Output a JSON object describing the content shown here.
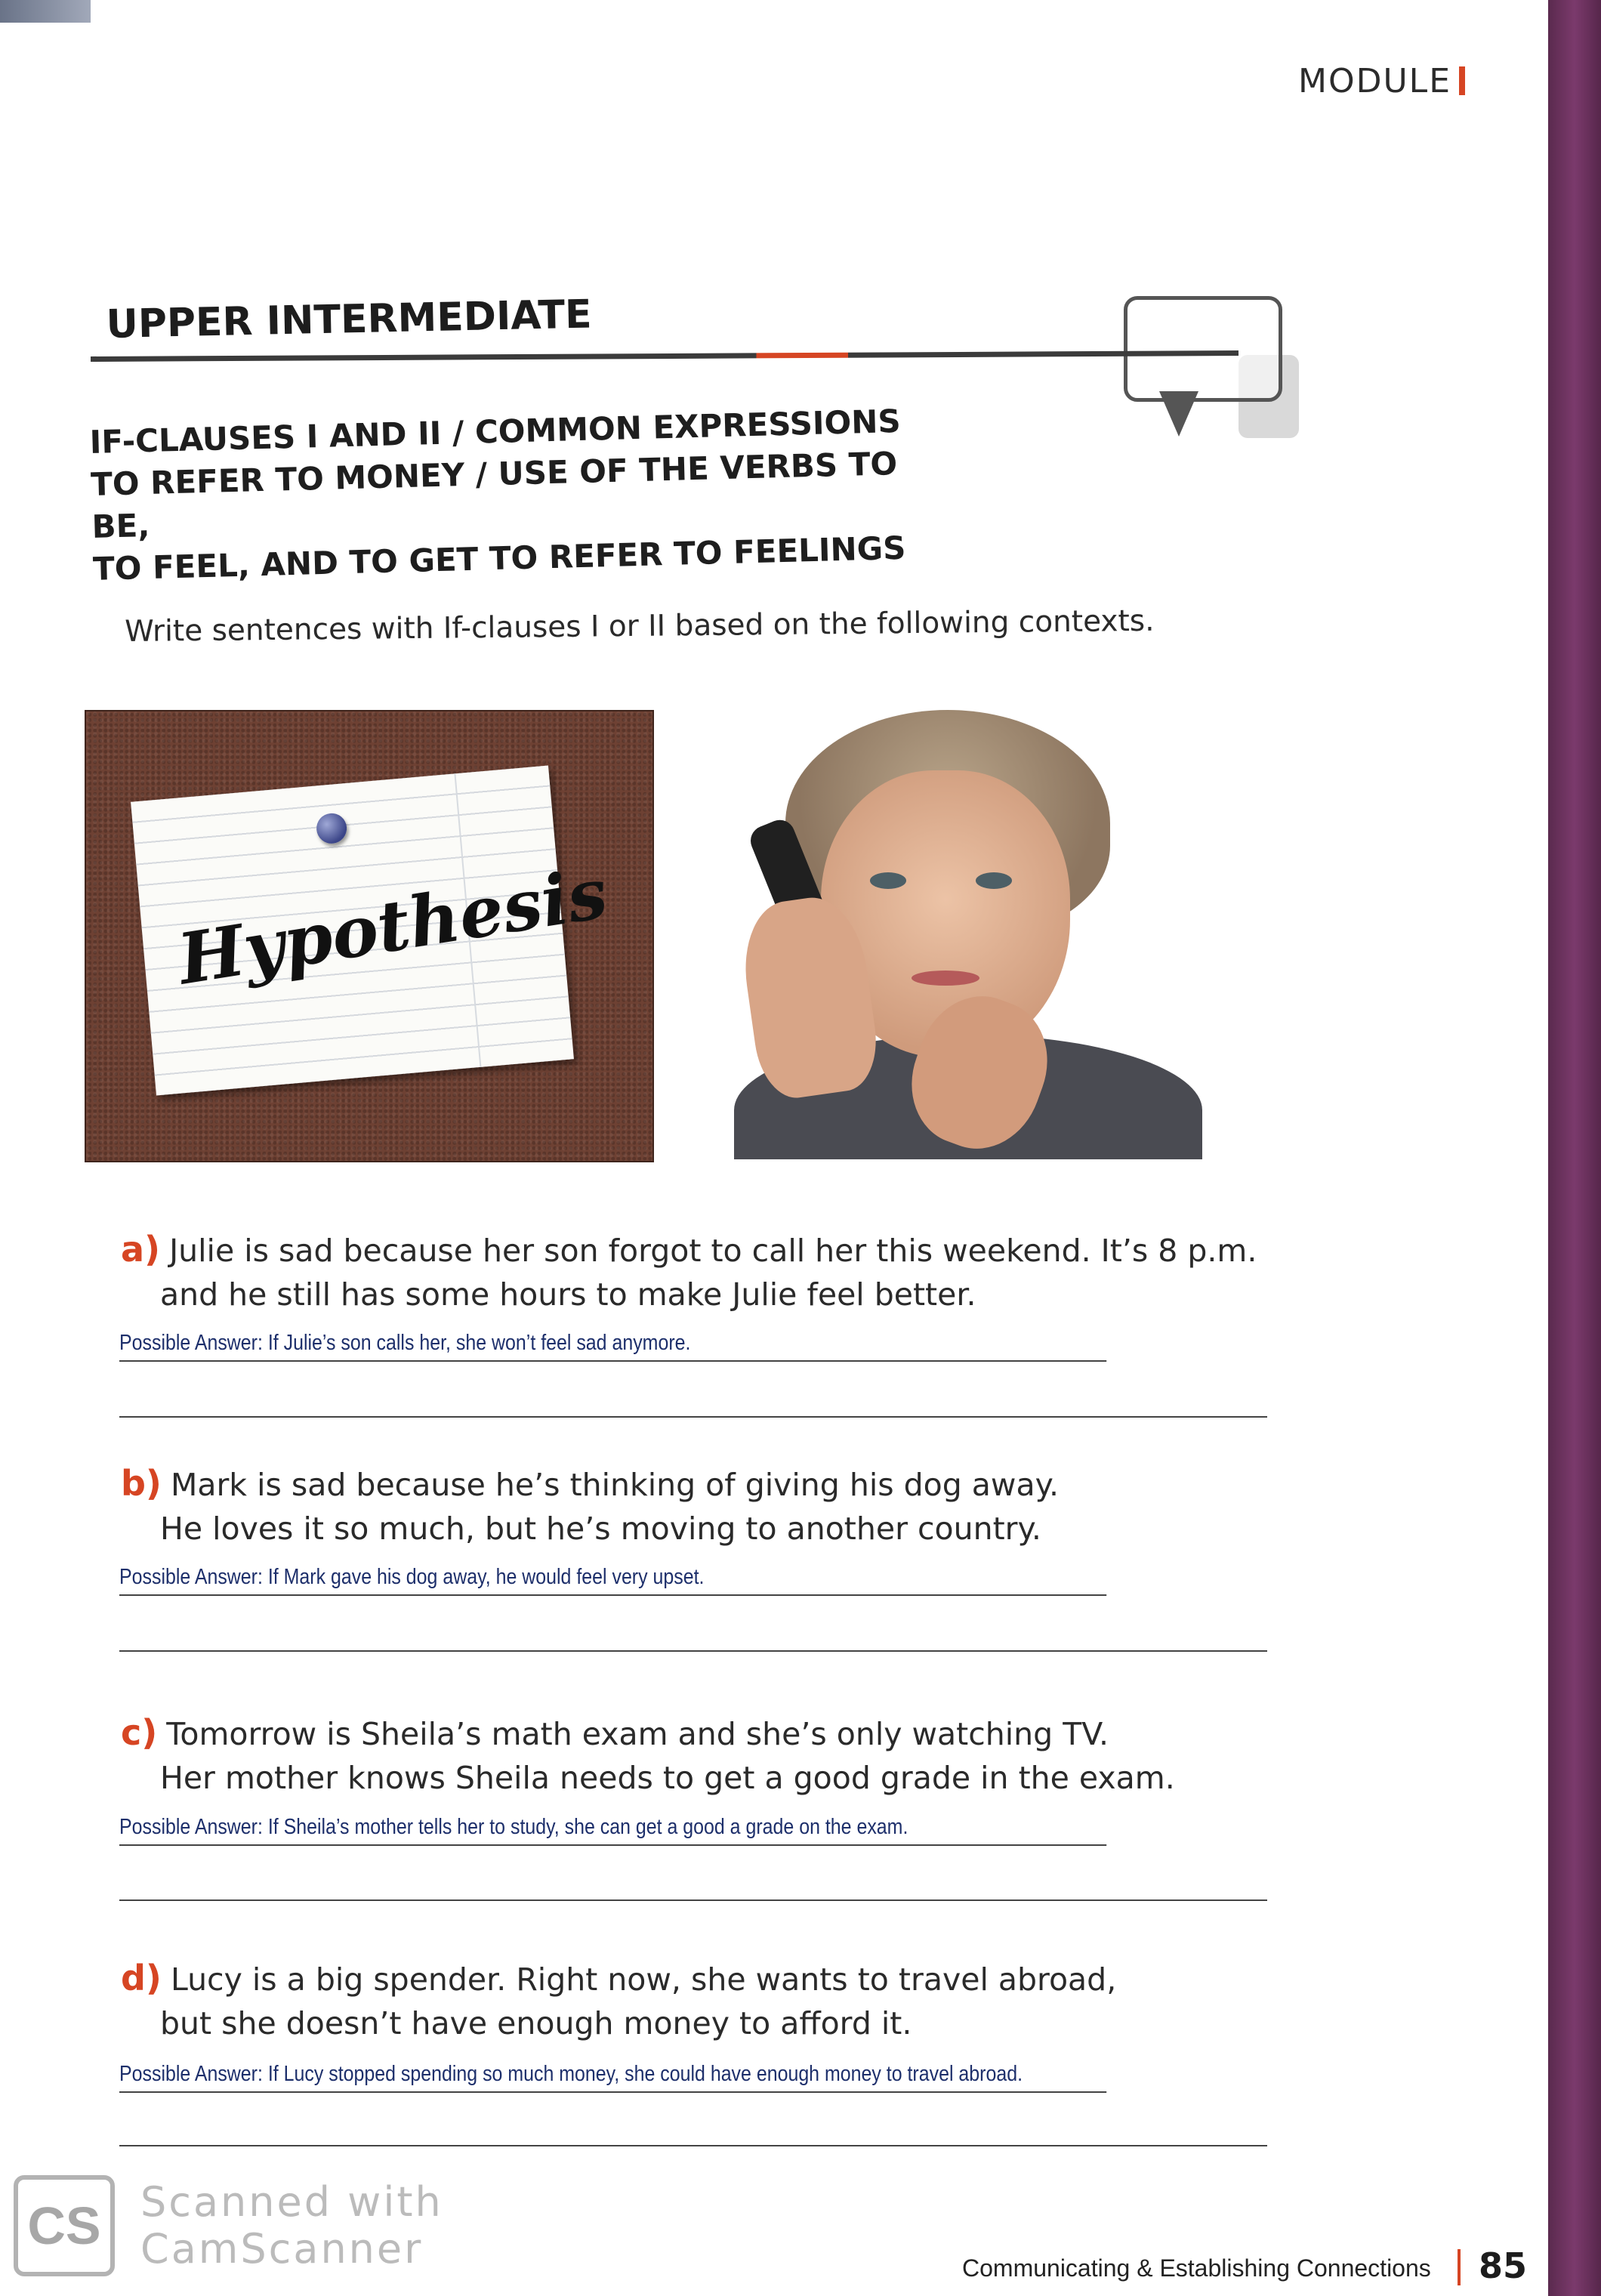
{
  "header": {
    "module_label": "MODULE"
  },
  "section": {
    "level": "UPPER INTERMEDIATE",
    "topic_lines": [
      "IF-CLAUSES I AND II / COMMON EXPRESSIONS",
      "TO REFER TO MONEY / USE OF THE VERBS TO BE,",
      "TO FEEL, AND TO GET TO REFER TO FEELINGS"
    ],
    "instruction": "Write sentences with If-clauses I or II based on the following contexts."
  },
  "images": {
    "note_word": "Hypothesis"
  },
  "exercises": [
    {
      "letter": "a)",
      "line1": "Julie is sad because her son forgot to call her this weekend. It’s 8 p.m.",
      "line2": "and he still has some hours to make Julie feel better.",
      "answer": "Possible Answer: If Julie’s son calls her, she won’t feel sad anymore."
    },
    {
      "letter": "b)",
      "line1": "Mark is sad because he’s thinking of giving his dog away.",
      "line2": "He loves it so much, but he’s moving to another country.",
      "answer": "Possible Answer: If Mark gave his dog away, he would feel very upset."
    },
    {
      "letter": "c)",
      "line1": "Tomorrow is Sheila’s math exam and she’s only watching TV.",
      "line2": "Her mother knows Sheila needs to get a good grade in the exam.",
      "answer": "Possible Answer: If Sheila’s mother tells her to study, she can get a good a grade on the exam."
    },
    {
      "letter": "d)",
      "line1": "Lucy is a big spender. Right now, she wants to travel abroad,",
      "line2": "but she doesn’t have enough money to afford it.",
      "answer": "Possible Answer: If Lucy stopped spending so much money, she could have enough money to travel abroad."
    }
  ],
  "footer": {
    "section_name": "Communicating & Establishing Connections",
    "page_number": "85"
  },
  "watermark": {
    "logo": "CS",
    "line1": "Scanned with",
    "line2": "CamScanner"
  },
  "colors": {
    "accent": "#d64523",
    "answer_ink": "#1d2f6b"
  }
}
